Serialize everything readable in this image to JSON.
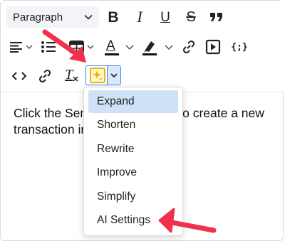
{
  "toolbar": {
    "paragraph_select": {
      "value": "Paragraph",
      "icon": "chevron-down-icon"
    },
    "row1_icons": [
      "bold-icon",
      "italic-icon",
      "underline-icon",
      "strikethrough-icon",
      "blockquote-icon"
    ],
    "row2_icons": [
      "align-icon",
      "bullet-list-icon",
      "table-icon",
      "text-color-icon",
      "highlight-icon",
      "link-icon",
      "media-embed-icon",
      "code-block-icon"
    ],
    "row3_icons": [
      "inline-code-icon",
      "unlink-icon",
      "clear-format-icon",
      "ai-assistant-icon"
    ],
    "labels": {
      "bold": "B",
      "italic": "I",
      "underline": "U",
      "strike": "S",
      "text_color": "A",
      "clear_format": "T",
      "code_block": "{;}",
      "inline_code": "<>"
    }
  },
  "ai_menu": {
    "items": [
      {
        "label": "Expand",
        "active": true
      },
      {
        "label": "Shorten",
        "active": false
      },
      {
        "label": "Rewrite",
        "active": false
      },
      {
        "label": "Improve",
        "active": false
      },
      {
        "label": "Simplify",
        "active": false
      },
      {
        "label": "AI Settings",
        "active": false
      }
    ]
  },
  "content": {
    "line1": "Click the Sen",
    "line1b": "o create a new",
    "line2": "transaction in"
  },
  "colors": {
    "accent": "#3b82f6",
    "menu_active": "#cfe1f7",
    "annotation_arrow": "#f0314e",
    "spark": "#f1b400"
  }
}
